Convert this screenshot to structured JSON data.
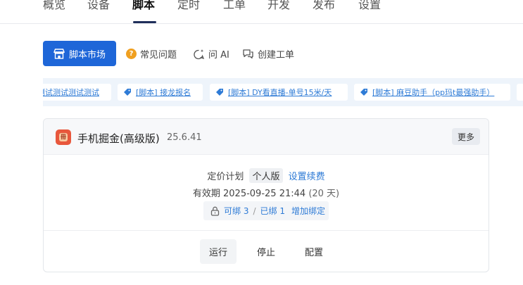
{
  "nav": {
    "items": [
      "概览",
      "设备",
      "脚本",
      "定时",
      "工单",
      "开发",
      "发布",
      "设置"
    ],
    "active_index": 2
  },
  "toolbar": {
    "market_label": "脚本市场",
    "faq_label": "常见问题",
    "ask_ai_label": "问 AI",
    "create_ticket_label": "创建工单"
  },
  "strip": {
    "items": [
      "测试测试测试测试",
      "[脚本] 接龙报名",
      "[脚本] DY看直播-单号15米/天",
      "[脚本] 麻豆助手（pp玛t最强助手）"
    ]
  },
  "card": {
    "name": "手机掘金(高级版)",
    "version": "25.6.41",
    "more_label": "更多",
    "plan_label": "定价计划",
    "plan_value": "个人版",
    "renew_label": "设置续费",
    "expiry_label": "有效期",
    "expiry_value": "2025-09-25 21:44",
    "expiry_days": "(20 天)",
    "bind_available": "可绑 3",
    "bind_separator": "/",
    "bind_used": "已绑 1",
    "bind_add": "增加绑定",
    "actions": [
      "运行",
      "停止",
      "配置"
    ]
  },
  "colors": {
    "primary": "#1e66d8",
    "link": "#2e7bd6",
    "strip_bg": "#eef4fb",
    "faq_dot": "#f0a020",
    "app_icon": "#e8573c"
  }
}
